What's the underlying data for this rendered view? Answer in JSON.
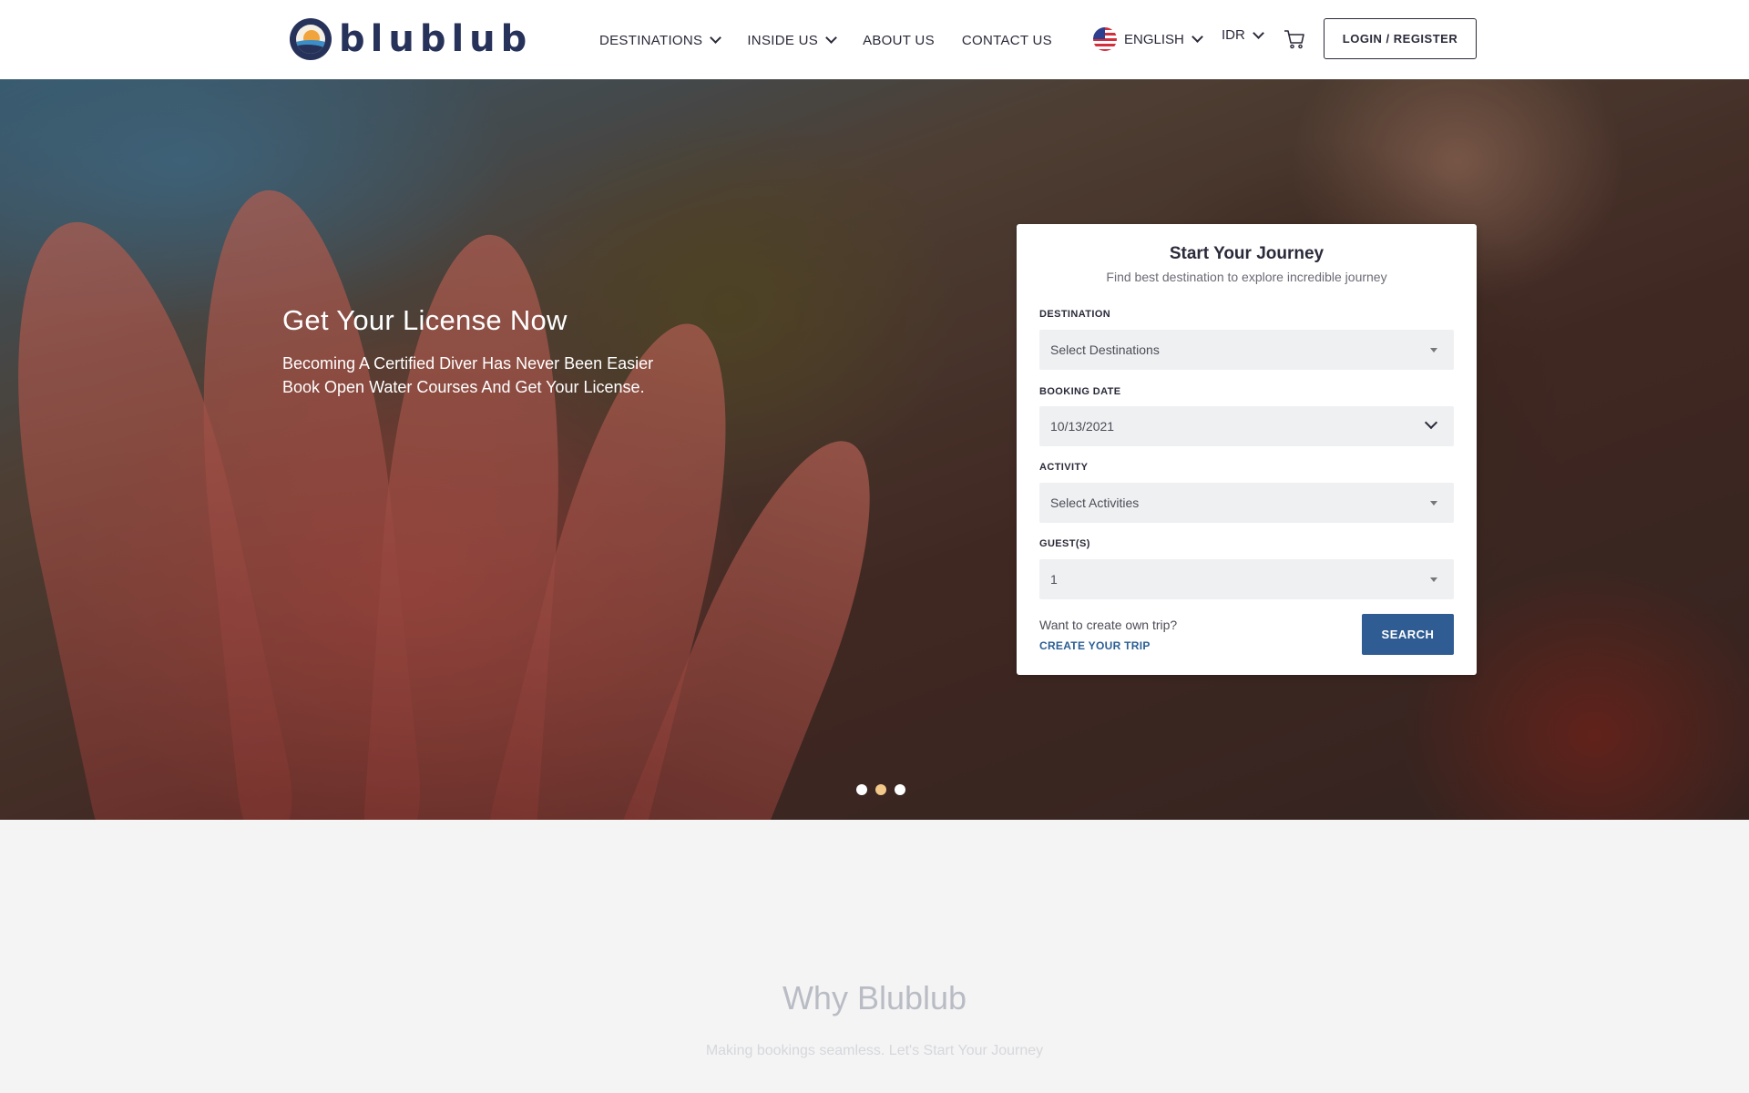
{
  "brand": {
    "name": "blublub"
  },
  "nav": {
    "items": [
      {
        "label": "DESTINATIONS",
        "has_dropdown": true
      },
      {
        "label": "INSIDE US",
        "has_dropdown": true
      },
      {
        "label": "ABOUT US",
        "has_dropdown": false
      },
      {
        "label": "CONTACT US",
        "has_dropdown": false
      }
    ],
    "language": "ENGLISH",
    "currency": "IDR",
    "login_label": "LOGIN / REGISTER"
  },
  "hero": {
    "title": "Get Your License Now",
    "subtitle_line1": "Becoming A Certified Diver Has Never Been Easier",
    "subtitle_line2": "Book Open Water Courses And Get Your License.",
    "slide_count": 3,
    "active_slide": 2
  },
  "booking": {
    "title": "Start Your Journey",
    "subtitle": "Find best destination to explore incredible journey",
    "destination": {
      "label": "DESTINATION",
      "value": "Select Destinations"
    },
    "date": {
      "label": "BOOKING DATE",
      "value": "10/13/2021"
    },
    "activity": {
      "label": "ACTIVITY",
      "value": "Select Activities"
    },
    "guests": {
      "label": "GUEST(S)",
      "value": "1"
    },
    "own_trip_text": "Want to create own trip?",
    "create_trip_label": "CREATE YOUR TRIP",
    "search_label": "SEARCH"
  },
  "why": {
    "title": "Why Blublub",
    "subtitle": "Making bookings seamless. Let's Start Your Journey"
  },
  "colors": {
    "primary": "#2f5d93",
    "link": "#2a5e95",
    "brand_navy": "#27325a",
    "active_dot": "#f2c98a"
  }
}
